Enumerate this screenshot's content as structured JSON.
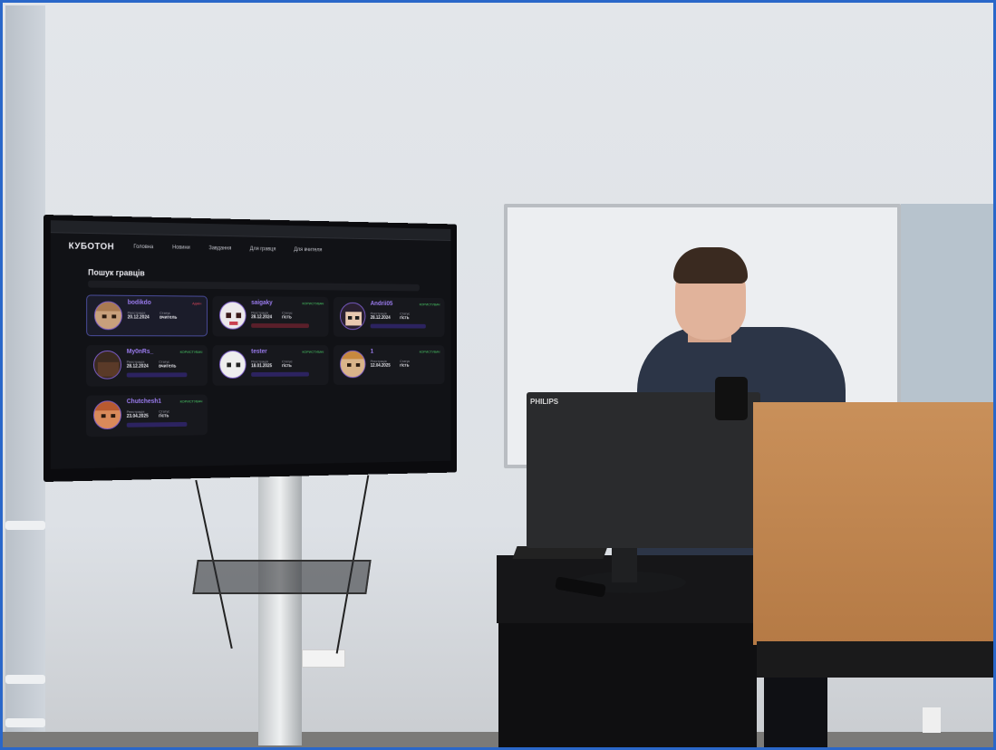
{
  "screen": {
    "site": {
      "logo": "КУБОТОН",
      "nav": [
        "Головна",
        "Новини",
        "Завдання",
        "Для гравця",
        "Для вчителя"
      ]
    },
    "page_title": "Пошук гравців",
    "meta_labels": {
      "registration": "Реєстрація",
      "status": "Статус"
    },
    "players": [
      {
        "name": "bodikdo",
        "role": "Адмін",
        "date": "20.12.2024",
        "status": "вчитель"
      },
      {
        "name": "saigaky",
        "role": "КОРИСТУВАЧ",
        "date": "28.12.2024",
        "status": "гість"
      },
      {
        "name": "Andrii05",
        "role": "КОРИСТУВАЧ",
        "date": "28.12.2024",
        "status": "гість"
      },
      {
        "name": "My0nRs_",
        "role": "КОРИСТУВАЧ",
        "date": "28.12.2024",
        "status": "вчитель"
      },
      {
        "name": "tester",
        "role": "КОРИСТУВАЧ",
        "date": "18.01.2025",
        "status": "гість"
      },
      {
        "name": "1",
        "role": "КОРИСТУВАЧ",
        "date": "12.04.2025",
        "status": "гість"
      },
      {
        "name": "Chutchesh1",
        "role": "КОРИСТУВАЧ",
        "date": "23.04.2025",
        "status": "гість"
      }
    ]
  },
  "monitor": {
    "brand": "PHILIPS"
  },
  "colors": {
    "frame": "#2a67c9",
    "screen_bg": "#111216",
    "username": "#9b7cf0",
    "lectern": "#c9905a"
  }
}
